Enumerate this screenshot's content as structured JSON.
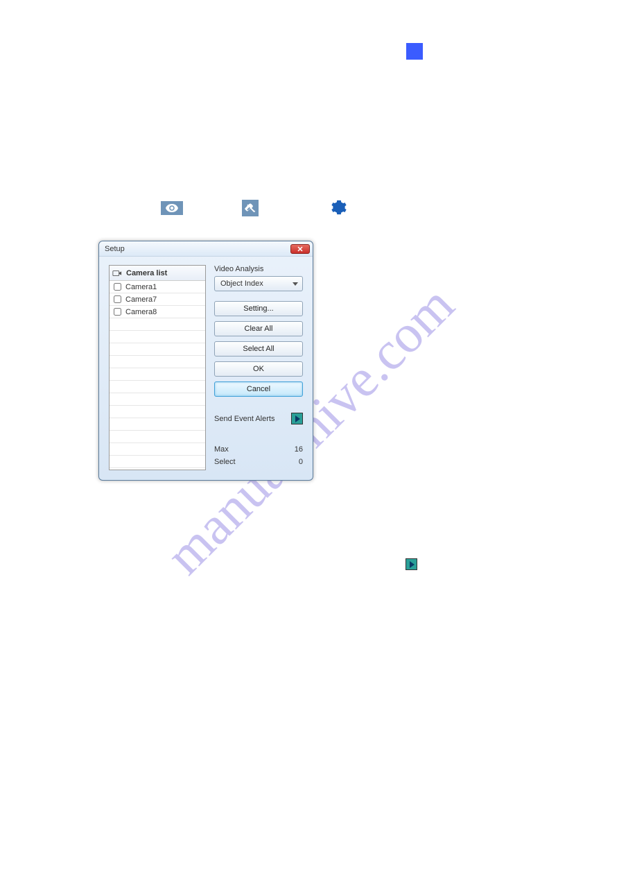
{
  "watermark": "manualshive.com",
  "dialog": {
    "title": "Setup",
    "camera_list_header": "Camera list",
    "cameras": [
      "Camera1",
      "Camera7",
      "Camera8"
    ],
    "section_label": "Video Analysis",
    "dropdown_value": "Object Index",
    "buttons": {
      "setting": "Setting...",
      "clear_all": "Clear All",
      "select_all": "Select All",
      "ok": "OK",
      "cancel": "Cancel"
    },
    "send_event_alerts": "Send Event Alerts",
    "stats": {
      "max_label": "Max",
      "max_value": "16",
      "select_label": "Select",
      "select_value": "0"
    }
  }
}
